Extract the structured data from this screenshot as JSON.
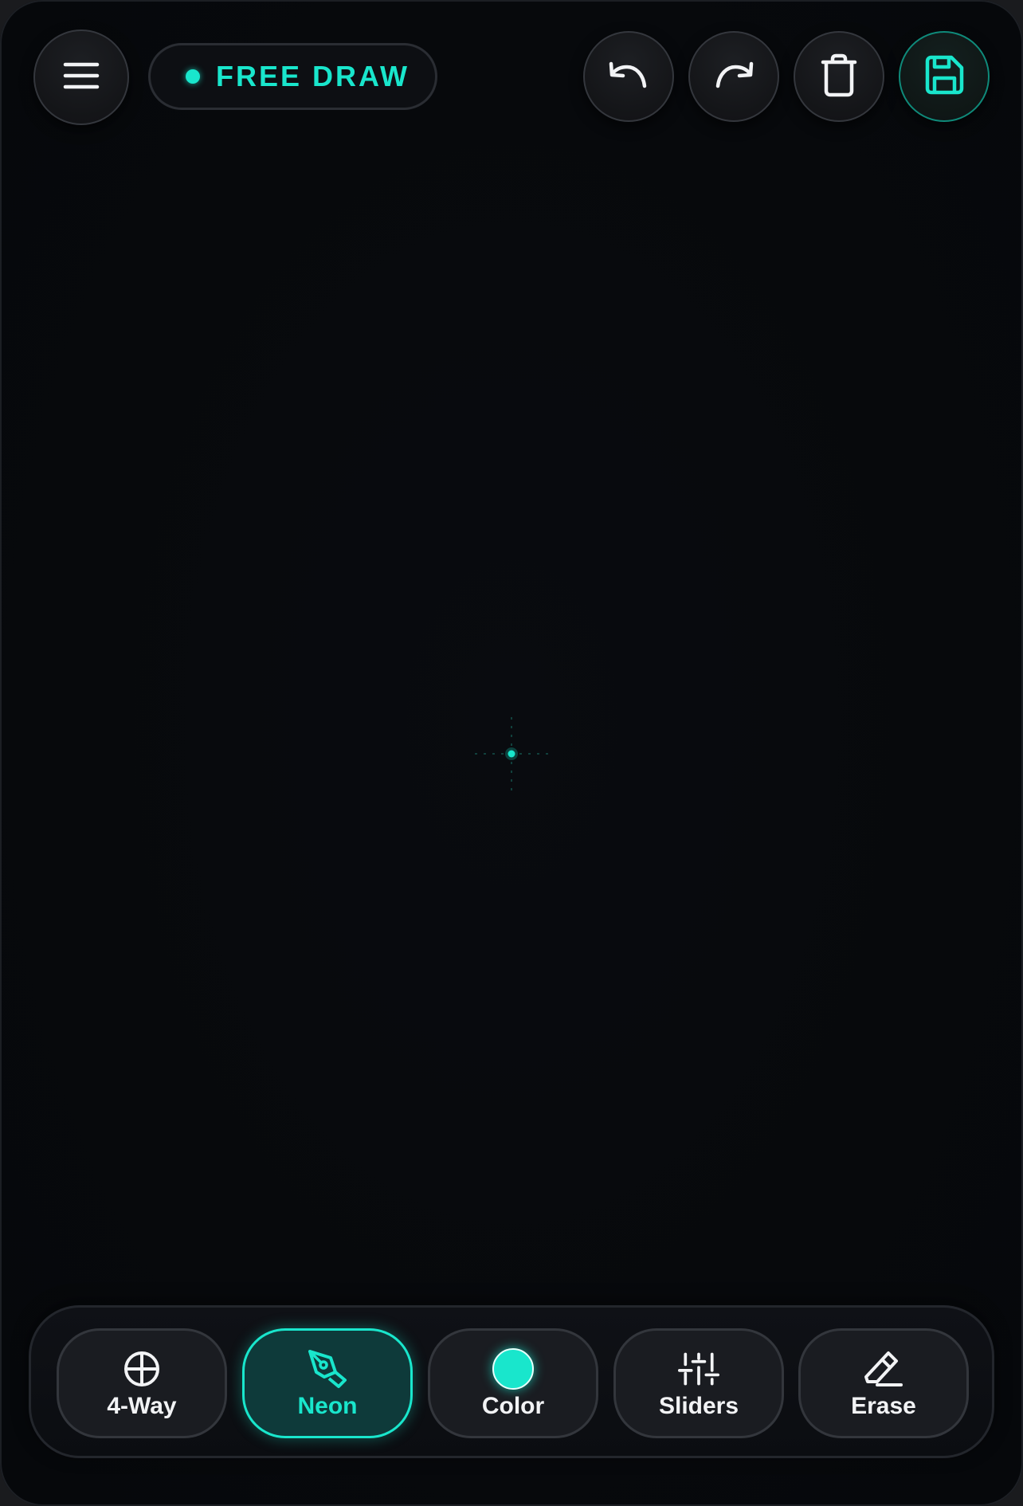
{
  "app": {
    "mode_label": "FREE DRAW",
    "accent_color": "#19e6cc"
  },
  "header": {
    "menu_icon": "hamburger-icon",
    "actions": [
      {
        "name": "undo",
        "icon": "undo-icon"
      },
      {
        "name": "redo",
        "icon": "redo-icon"
      },
      {
        "name": "delete",
        "icon": "trash-icon"
      },
      {
        "name": "save",
        "icon": "save-icon"
      }
    ]
  },
  "canvas": {
    "cursor_icon": "crosshair-icon"
  },
  "toolbar": {
    "active_tool": "Neon",
    "tools": [
      {
        "label": "4-Way",
        "icon": "four-way-icon"
      },
      {
        "label": "Neon",
        "icon": "pen-icon"
      },
      {
        "label": "Color",
        "icon": "color-swatch"
      },
      {
        "label": "Sliders",
        "icon": "sliders-icon"
      },
      {
        "label": "Erase",
        "icon": "eraser-icon"
      }
    ]
  }
}
